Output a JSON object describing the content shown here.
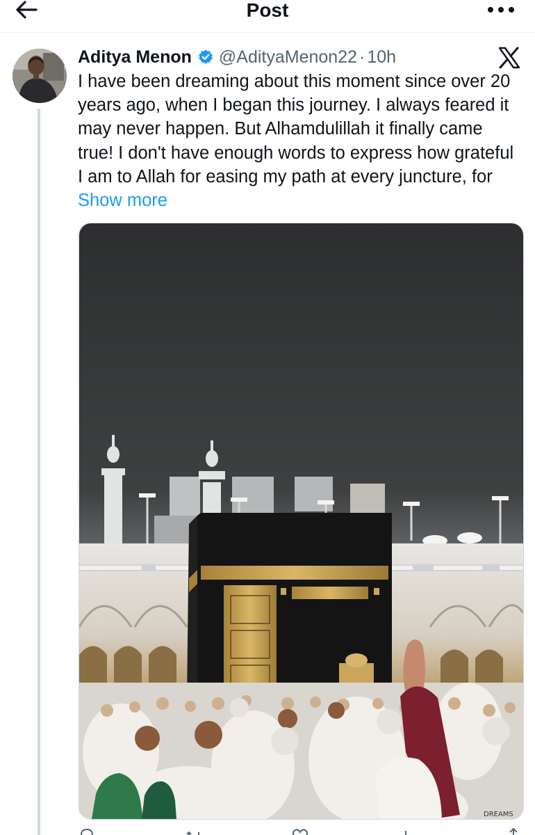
{
  "header": {
    "title": "Post",
    "back_icon": "arrow-left-icon",
    "more_icon": "more-dots-icon"
  },
  "tweet": {
    "author_name": "Aditya Menon",
    "handle": "@AdityaMenon22",
    "separator": "·",
    "time_ago": "10h",
    "verified_icon": "verified-badge-icon",
    "source_icon": "x-logo-icon",
    "text": "I have been dreaming about this moment since over 20 years ago, when I began this journey. I always feared it may never happen. But Alhamdulillah it finally came true! I don't have enough words to express how grateful I am to Allah for easing my path at every juncture, for ",
    "show_more": "Show more",
    "image_caption_fragment": "DREAMS"
  },
  "colors": {
    "text": "#0f1419",
    "secondary": "#536471",
    "link": "#1d9bf0",
    "verified": "#1d9bf0",
    "divider": "#cfd9de"
  }
}
